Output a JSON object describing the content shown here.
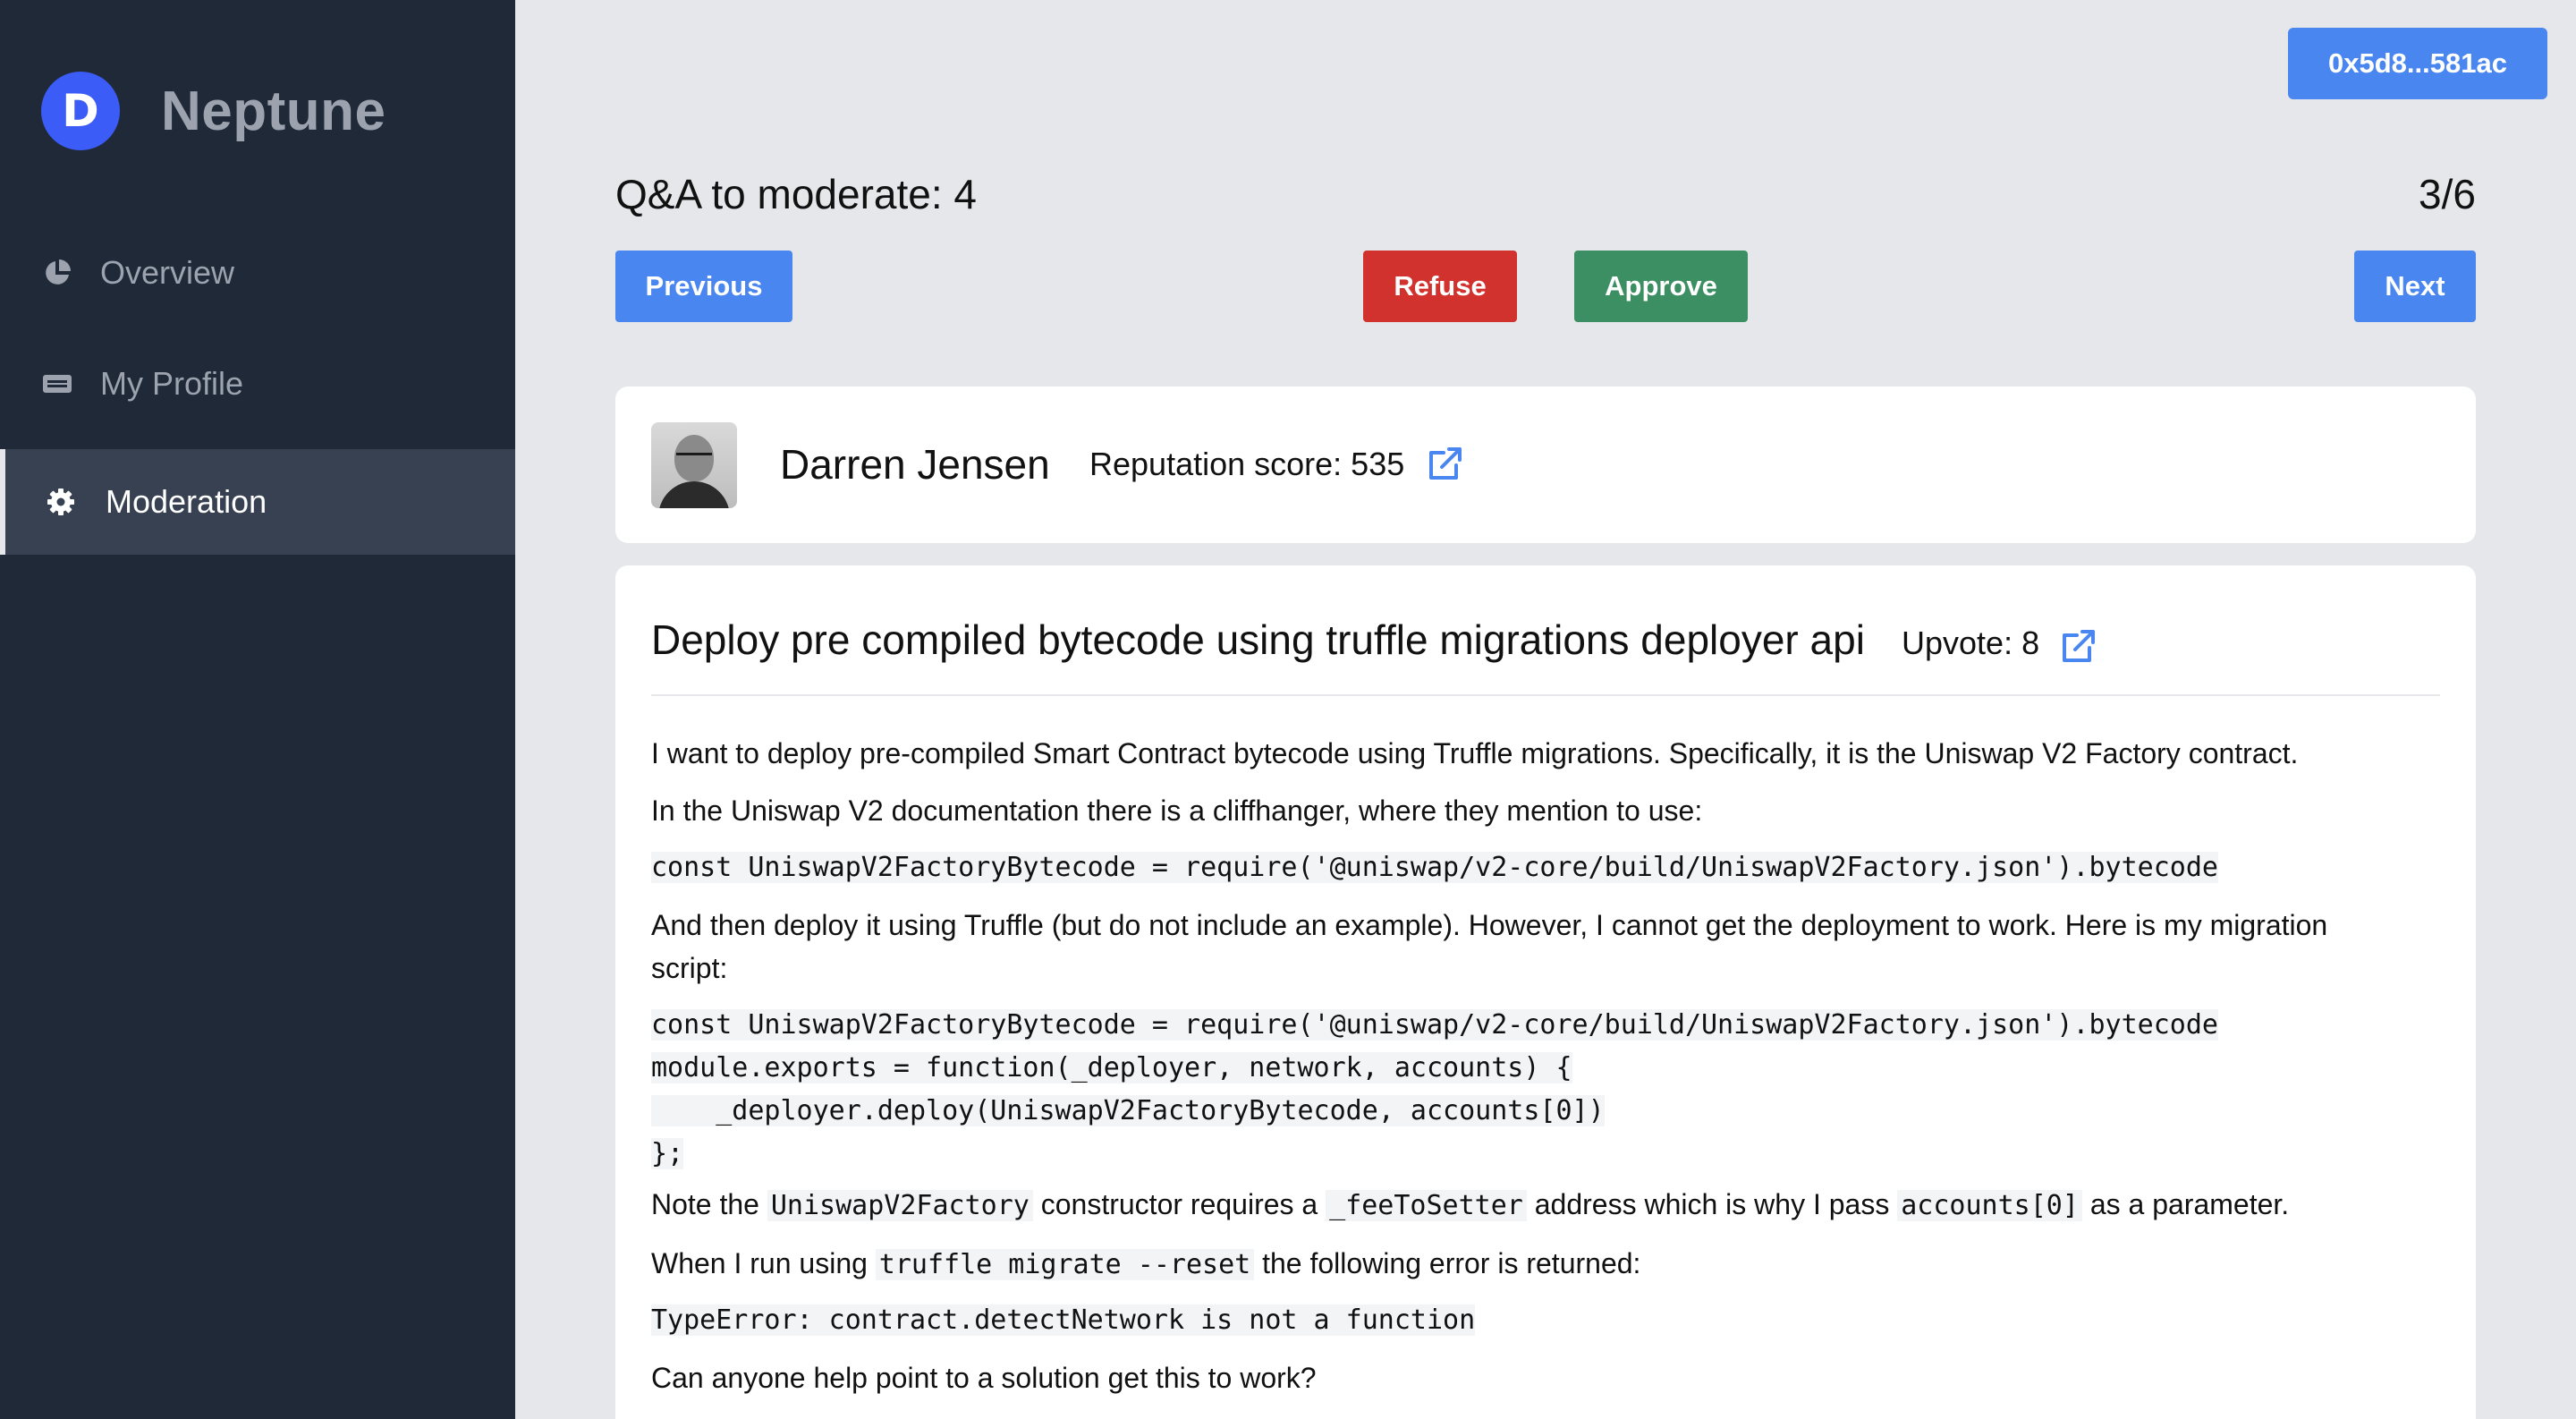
{
  "sidebar": {
    "brand_initial": "D",
    "brand_name": "Neptune",
    "items": [
      {
        "label": "Overview",
        "icon": "pie-chart-icon",
        "active": false
      },
      {
        "label": "My Profile",
        "icon": "id-card-icon",
        "active": false
      },
      {
        "label": "Moderation",
        "icon": "gear-icon",
        "active": true
      }
    ]
  },
  "header": {
    "wallet_address": "0x5d8...581ac",
    "moderate_title": "Q&A to moderate: 4",
    "counter": "3/6"
  },
  "actions": {
    "previous": "Previous",
    "refuse": "Refuse",
    "approve": "Approve",
    "next": "Next"
  },
  "author": {
    "name": "Darren Jensen",
    "reputation": "Reputation score: 535"
  },
  "question": {
    "title": "Deploy pre compiled bytecode using truffle migrations deployer api",
    "upvote": "Upvote: 8",
    "p1": "I want to deploy pre-compiled Smart Contract bytecode using Truffle migrations. Specifically, it is the Uniswap V2 Factory contract.",
    "p2": "In the Uniswap V2 documentation there is a cliffhanger, where they mention to use:",
    "code1": "const UniswapV2FactoryBytecode = require('@uniswap/v2-core/build/UniswapV2Factory.json').bytecode",
    "p3a": "And then deploy it using Truffle (but do not include an example). However, I cannot get the deployment to work. Here is my migration",
    "p3b": "script:",
    "code2": [
      "const UniswapV2FactoryBytecode = require('@uniswap/v2-core/build/UniswapV2Factory.json').bytecode",
      "module.exports = function(_deployer, network, accounts) {",
      "    _deployer.deploy(UniswapV2FactoryBytecode, accounts[0])",
      "};"
    ],
    "p4": {
      "t1": "Note the ",
      "c1": "UniswapV2Factory",
      "t2": " constructor requires a ",
      "c2": "_feeToSetter",
      "t3": " address which is why I pass ",
      "c3": "accounts[0]",
      "t4": " as a parameter."
    },
    "p5": {
      "t1": "When I run using ",
      "c1": "truffle migrate --reset",
      "t2": " the following error is returned:"
    },
    "code3": "TypeError: contract.detectNetwork is not a function",
    "p6": "Can anyone help point to a solution get this to work?"
  },
  "colors": {
    "sidebar_bg": "#1f2937",
    "primary": "#4a86f0",
    "danger": "#d2322d",
    "success": "#3c8f62",
    "brand": "#3b5cf6"
  }
}
